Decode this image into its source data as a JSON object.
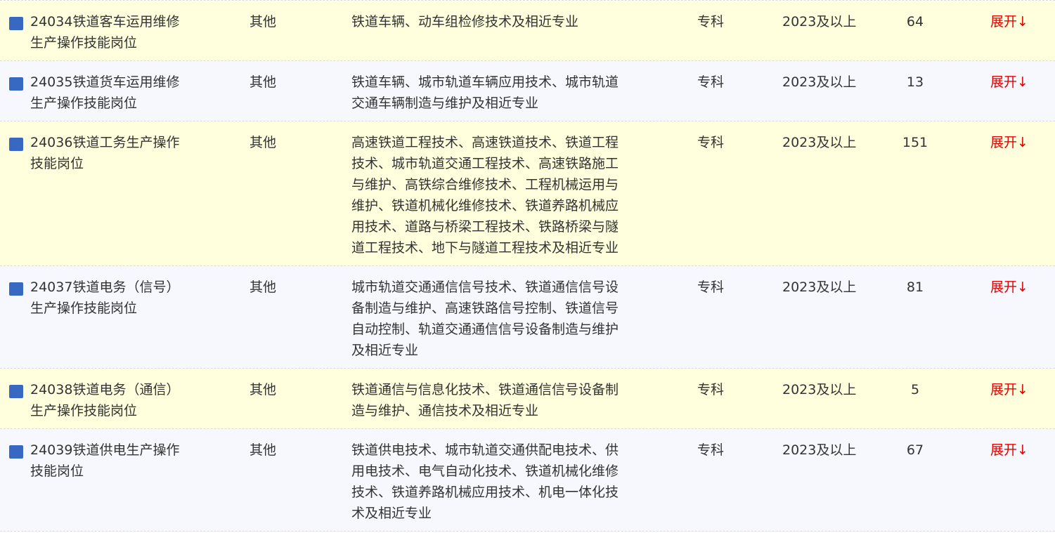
{
  "colors": {
    "row_odd_bg": "#ffffdd",
    "row_even_bg": "#f7f8fe",
    "marker": "#3768c2",
    "expand_text": "#e60000",
    "text": "#333333"
  },
  "rows": [
    {
      "name_lines": [
        "24034铁道客车运用维修",
        "生产操作技能岗位"
      ],
      "category": "其他",
      "major_lines": [
        "铁道车辆、动车组检修技术及相近专业"
      ],
      "education": "专科",
      "year": "2023及以上",
      "count": "64",
      "expand": "展开↓"
    },
    {
      "name_lines": [
        "24035铁道货车运用维修",
        "生产操作技能岗位"
      ],
      "category": "其他",
      "major_lines": [
        "铁道车辆、城市轨道车辆应用技术、城市轨道",
        "交通车辆制造与维护及相近专业"
      ],
      "education": "专科",
      "year": "2023及以上",
      "count": "13",
      "expand": "展开↓"
    },
    {
      "name_lines": [
        "24036铁道工务生产操作",
        "技能岗位"
      ],
      "category": "其他",
      "major_lines": [
        "高速铁道工程技术、高速铁道技术、铁道工程",
        "技术、城市轨道交通工程技术、高速铁路施工",
        "与维护、高铁综合维修技术、工程机械运用与",
        "维护、铁道机械化维修技术、铁道养路机械应",
        "用技术、道路与桥梁工程技术、铁路桥梁与隧",
        "道工程技术、地下与隧道工程技术及相近专业"
      ],
      "education": "专科",
      "year": "2023及以上",
      "count": "151",
      "expand": "展开↓"
    },
    {
      "name_lines": [
        "24037铁道电务（信号）",
        "生产操作技能岗位"
      ],
      "category": "其他",
      "major_lines": [
        "城市轨道交通通信信号技术、铁道通信信号设",
        "备制造与维护、高速铁路信号控制、铁道信号",
        "自动控制、轨道交通通信信号设备制造与维护",
        "及相近专业"
      ],
      "education": "专科",
      "year": "2023及以上",
      "count": "81",
      "expand": "展开↓"
    },
    {
      "name_lines": [
        "24038铁道电务（通信）",
        "生产操作技能岗位"
      ],
      "category": "其他",
      "major_lines": [
        "铁道通信与信息化技术、铁道通信信号设备制",
        "造与维护、通信技术及相近专业"
      ],
      "education": "专科",
      "year": "2023及以上",
      "count": "5",
      "expand": "展开↓"
    },
    {
      "name_lines": [
        "24039铁道供电生产操作",
        "技能岗位"
      ],
      "category": "其他",
      "major_lines": [
        "铁道供电技术、城市轨道交通供配电技术、供",
        "用电技术、电气自动化技术、铁道机械化维修",
        "技术、铁道养路机械应用技术、机电一体化技",
        "术及相近专业"
      ],
      "education": "专科",
      "year": "2023及以上",
      "count": "67",
      "expand": "展开↓"
    }
  ]
}
